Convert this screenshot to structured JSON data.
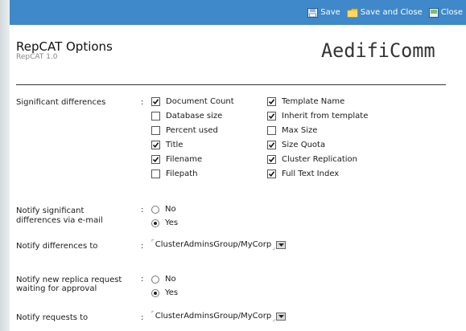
{
  "toolbar": {
    "save_label": "Save",
    "save_close_label": "Save and Close",
    "close_label": "Close",
    "background": "#3f88c9"
  },
  "header": {
    "title": "RepCAT Options",
    "subtitle": "RepCAT 1.0",
    "logo": "AedifiComm"
  },
  "significant_differences": {
    "label": "Significant differences",
    "colon": ":",
    "options": [
      {
        "label": "Document Count",
        "checked": true
      },
      {
        "label": "Database size",
        "checked": false
      },
      {
        "label": "Percent used",
        "checked": false
      },
      {
        "label": "Title",
        "checked": true
      },
      {
        "label": "Filename",
        "checked": true
      },
      {
        "label": "Filepath",
        "checked": false
      },
      {
        "label": "Template Name",
        "checked": true
      },
      {
        "label": "Inherit from template",
        "checked": true
      },
      {
        "label": "Max Size",
        "checked": false
      },
      {
        "label": "Size Quota",
        "checked": true
      },
      {
        "label": "Cluster Replication",
        "checked": true
      },
      {
        "label": "Full Text Index",
        "checked": true
      }
    ]
  },
  "notify_email": {
    "label_line1": "Notify significant",
    "label_line2": "differences via e-mail",
    "colon": ":",
    "options": [
      {
        "label": "No",
        "selected": false
      },
      {
        "label": "Yes",
        "selected": true
      }
    ]
  },
  "notify_differences_to": {
    "label": "Notify differences to",
    "colon": ":",
    "value": "ClusterAdminsGroup/MyCorp"
  },
  "notify_replica": {
    "label_line1": "Notify new replica request",
    "label_line2": "waiting for approval",
    "colon": ":",
    "options": [
      {
        "label": "No",
        "selected": false
      },
      {
        "label": "Yes",
        "selected": true
      }
    ]
  },
  "notify_requests_to": {
    "label": "Notify requests to",
    "colon": ":",
    "value": "ClusterAdminsGroup/MyCorp"
  }
}
